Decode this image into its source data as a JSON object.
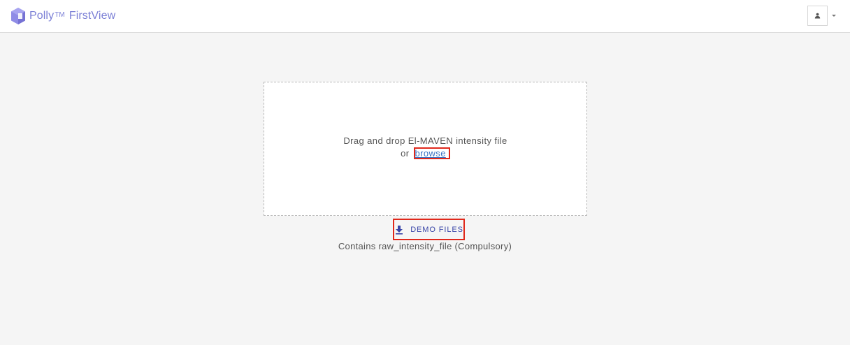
{
  "header": {
    "brand_name": "Polly",
    "brand_tm": "TM",
    "product_name": "FirstView",
    "logo_icon": "polly-logo-icon",
    "user_icon": "user-icon",
    "menu_caret_icon": "caret-down-icon"
  },
  "upload": {
    "instruction": "Drag and drop El-MAVEN intensity file",
    "or_text": "or",
    "browse_label": "browse"
  },
  "demo": {
    "button_label": "DEMO FILES",
    "button_icon": "download-icon",
    "note": "Contains raw_intensity_file (Compulsory)"
  },
  "colors": {
    "brand": "#7b7fd6",
    "link": "#3b73c4",
    "demo_text": "#3a46a8",
    "highlight_box": "#e0281b",
    "background": "#f5f5f5"
  }
}
